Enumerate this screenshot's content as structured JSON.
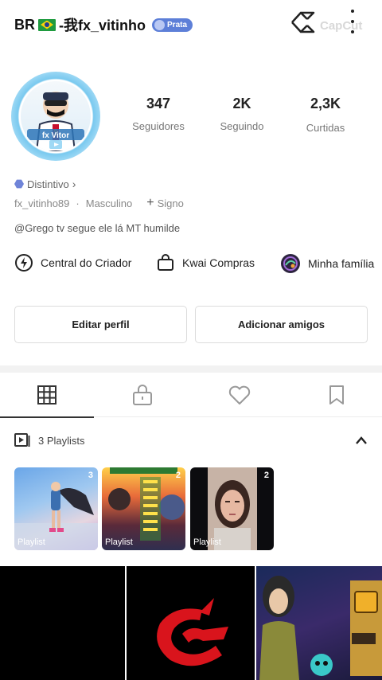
{
  "header": {
    "username_prefix": "BR",
    "username_suffix": "-我fx_vitinho",
    "level_badge": "Prata",
    "watermark": "CapCut"
  },
  "profile": {
    "avatar_caption": "fx Vitor"
  },
  "stats": [
    {
      "value": "347",
      "label": "Seguidores"
    },
    {
      "value": "2K",
      "label": "Seguindo"
    },
    {
      "value": "2,3K",
      "label": "Curtidas"
    }
  ],
  "badges": {
    "label": "Distintivo"
  },
  "meta": {
    "handle": "fx_vitinho89",
    "separator": "·",
    "gender": "Masculino",
    "sign": "Signo"
  },
  "bio": "@Grego tv segue ele lá MT humilde",
  "shortcuts": [
    {
      "label": "Central do Criador",
      "icon": "lightning-icon"
    },
    {
      "label": "Kwai Compras",
      "icon": "shopping-bag-icon"
    },
    {
      "label": "Minha família",
      "icon": "family-avatar-icon"
    }
  ],
  "actions": {
    "edit_profile": "Editar perfil",
    "add_friends": "Adicionar amigos"
  },
  "tabs": [
    {
      "icon": "grid-icon",
      "active": true
    },
    {
      "icon": "lock-icon",
      "active": false
    },
    {
      "icon": "heart-icon",
      "active": false
    },
    {
      "icon": "bookmark-icon",
      "active": false
    }
  ],
  "playlists": {
    "header": "3 Playlists",
    "items": [
      {
        "count": "3",
        "label": "Playlist"
      },
      {
        "count": "2",
        "label": "Playlist"
      },
      {
        "count": "2",
        "label": "Playlist"
      }
    ]
  },
  "colors": {
    "accent": "#5d7fd8",
    "text": "#222222",
    "muted": "#777777"
  }
}
